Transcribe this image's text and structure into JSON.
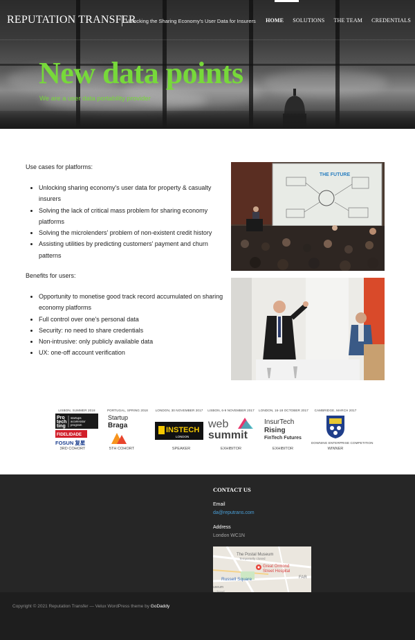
{
  "header": {
    "brand": "REPUTATION TRANSFER",
    "tagline": "Unlocking the Sharing Economy's User Data for Insurers",
    "nav": [
      "HOME",
      "SOLUTIONS",
      "THE TEAM",
      "CREDENTIALS"
    ],
    "active_nav": "HOME"
  },
  "hero": {
    "title": "New data points",
    "subtitle": "We are a user data portability provider"
  },
  "platforms": {
    "heading": "Use cases for platforms:",
    "items": [
      "Unlocking sharing economy's user data for property & casualty insurers",
      "Solving the lack of critical mass problem for sharing economy platforms",
      "Solving the microlenders' problem of non-existent credit history",
      "Assisting utilities by predicting customers' payment and churn patterns"
    ]
  },
  "users": {
    "heading": "Benefits for users:",
    "items": [
      "Opportunity to monetise good track record accumulated on sharing economy platforms",
      "Full control over one's personal data",
      "Security: no need to share credentials",
      "Non-intrusive: only publicly available data",
      "UX: one-off account verification"
    ]
  },
  "photos": {
    "slide_title": "THE FUTURE"
  },
  "credentials": [
    {
      "caption": "LISBON, SUMMER 2018",
      "role": "3RD COHORT",
      "lines": [
        "Pro",
        "tech",
        "ting",
        "startups",
        "accelerator",
        "program",
        "FIDELIDADE",
        "FOSUN 复星"
      ]
    },
    {
      "caption": "PORTUGAL, SPRING 2018",
      "role": "5TH COHORT",
      "lines": [
        "Startup",
        "Braga"
      ]
    },
    {
      "caption": "LONDON, 30 NOVEMBER 2017",
      "role": "SPEAKER",
      "lines": [
        "INSTECH",
        "LONDON"
      ]
    },
    {
      "caption": "LISBON, 6-9 NOVEMBER 2017",
      "role": "EXHIBITOR",
      "lines": [
        "web",
        "summit"
      ]
    },
    {
      "caption": "LONDON, 16-18 OCTOBER 2017",
      "role": "EXHIBITOR",
      "lines": [
        "InsurTech",
        "Rising",
        "FinTech Futures"
      ]
    },
    {
      "caption": "CAMBRIDGE, MARCH 2017",
      "role": "WINNER",
      "lines": [
        "DOWNING ENTERPRISE COMPETITION"
      ]
    }
  ],
  "footer": {
    "contact_title": "CONTACT US",
    "email_label": "Email",
    "email": "da@reputrans.com",
    "address_label": "Address",
    "address": "London WC1N",
    "map_labels": [
      "The Postal Museum",
      "Temporarily closed",
      "Great Ormond",
      "Street Hospital",
      "Russell Square",
      "useum",
      "y closed",
      "FAR"
    ],
    "copyright": "Copyright © 2021 Reputation Transfer — Velux WordPress theme by",
    "copyright_link": "GoDaddy"
  },
  "colors": {
    "accent_green": "#77d93a",
    "footer_bg": "#262626",
    "link_blue": "#4aa0d9"
  }
}
